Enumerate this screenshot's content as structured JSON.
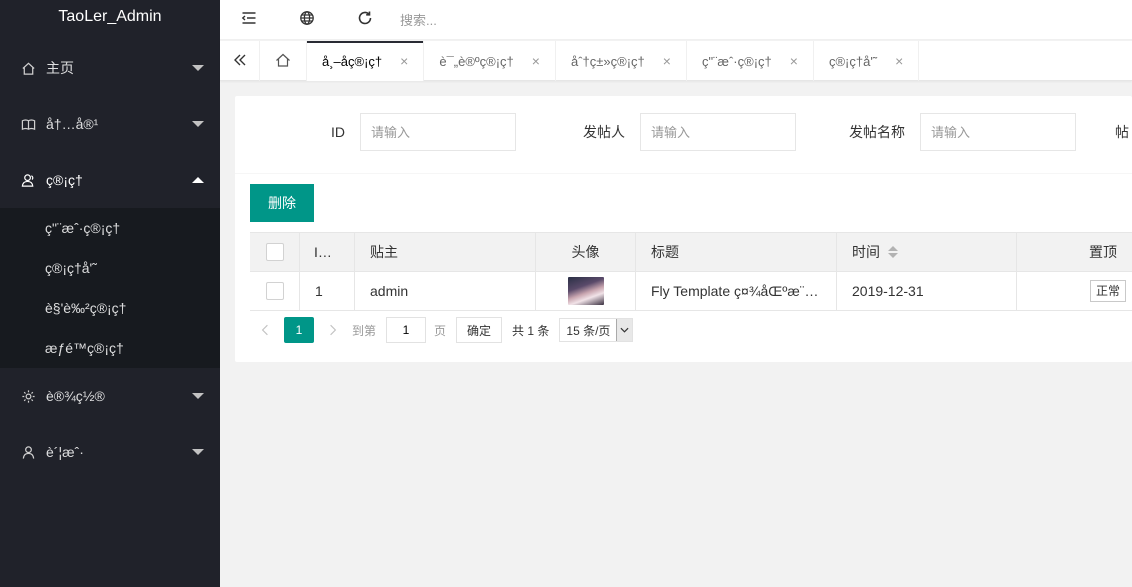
{
  "sidebar": {
    "logo": "TaoLer_Admin",
    "items": [
      {
        "label": "主页",
        "icon": "home-icon"
      },
      {
        "label": "å†…å®¹",
        "icon": "book-icon"
      },
      {
        "label": "ç®¡ç†",
        "icon": "user-group-icon",
        "open": true,
        "sub": [
          "ç\"¨æˆ·ç®¡ç†",
          "ç®¡ç†å'˜",
          "è§'è‰²ç®¡ç†",
          "æƒé™ç®¡ç†"
        ]
      },
      {
        "label": "è®¾ç½®",
        "icon": "gear-icon"
      },
      {
        "label": "è´¦æˆ·",
        "icon": "user-icon"
      }
    ]
  },
  "header": {
    "search_placeholder": "搜索..."
  },
  "tabs": {
    "items": [
      {
        "label": "å¸–å­ç®¡ç†",
        "active": true
      },
      {
        "label": "è¯„è®ºç®¡ç†",
        "active": false
      },
      {
        "label": "åˆ†ç±»ç®¡ç†",
        "active": false
      },
      {
        "label": "ç\"¨æˆ·ç®¡ç†",
        "active": false
      },
      {
        "label": "ç®¡ç†å'˜",
        "active": false
      }
    ],
    "close_glyph": "×"
  },
  "filters": {
    "id_label": "ID",
    "id_placeholder": "请输入",
    "poster_label": "发帖人",
    "poster_placeholder": "请输入",
    "title_label": "发帖名称",
    "title_placeholder": "请输入",
    "extra_label": "帖"
  },
  "actions": {
    "delete_label": "删除"
  },
  "table": {
    "headers": {
      "id": "I…",
      "owner": "贴主",
      "avatar": "头像",
      "title": "标题",
      "time": "时间",
      "pin": "置顶"
    },
    "rows": [
      {
        "id": "1",
        "owner": "admin",
        "title": "Fly Template ç¤¾åŒºæ¨…",
        "time": "2019-12-31",
        "pin": "正常"
      }
    ]
  },
  "pager": {
    "current": "1",
    "goto_label": "到第",
    "goto_value": "1",
    "page_unit": "页",
    "confirm": "确定",
    "total": "共 1 条",
    "per_page": "15 条/页"
  },
  "colors": {
    "accent": "#009688",
    "sidebar_bg": "#20222a",
    "subnav_bg": "#171a1f"
  }
}
